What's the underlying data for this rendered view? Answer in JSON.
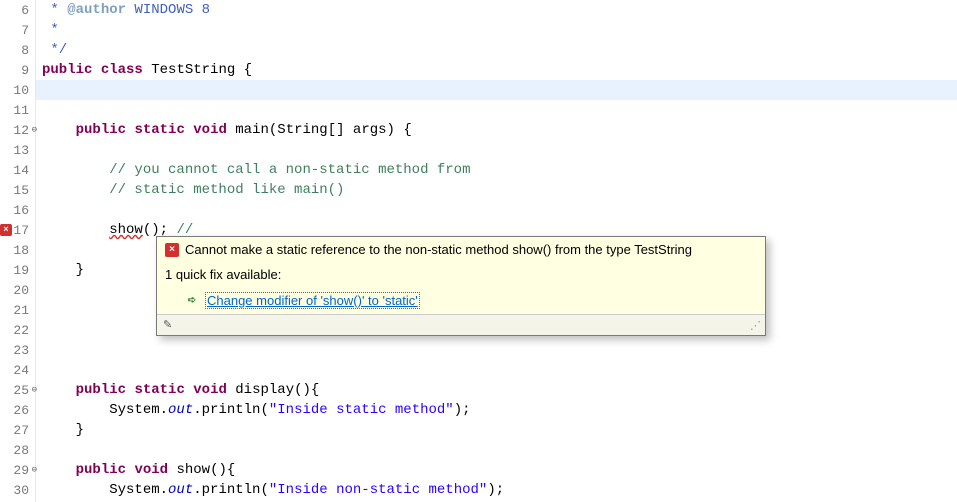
{
  "gutter": {
    "lines": [
      {
        "n": 6
      },
      {
        "n": 7
      },
      {
        "n": 8
      },
      {
        "n": 9
      },
      {
        "n": 10
      },
      {
        "n": 11
      },
      {
        "n": 12,
        "fold": true
      },
      {
        "n": 13
      },
      {
        "n": 14
      },
      {
        "n": 15
      },
      {
        "n": 16
      },
      {
        "n": 17,
        "error": true
      },
      {
        "n": 18
      },
      {
        "n": 19
      },
      {
        "n": 20
      },
      {
        "n": 21
      },
      {
        "n": 22
      },
      {
        "n": 23
      },
      {
        "n": 24
      },
      {
        "n": 25,
        "fold": true
      },
      {
        "n": 26
      },
      {
        "n": 27
      },
      {
        "n": 28
      },
      {
        "n": 29,
        "fold": true
      },
      {
        "n": 30
      }
    ]
  },
  "code": {
    "l6_jdoc_pre": " * ",
    "l6_tag": "@author",
    "l6_author": " WINDOWS 8",
    "l7": " *",
    "l8": " */",
    "l9_kw1": "public",
    "l9_kw2": "class",
    "l9_name": "TestString",
    "l9_brace": " {",
    "l12_kw1": "public",
    "l12_kw2": "static",
    "l12_kw3": "void",
    "l12_m": "main",
    "l12_p_open": "(",
    "l12_ptype": "String[] ",
    "l12_pname": "args",
    "l12_p_close": ") {",
    "l14_c": "// you cannot call a non-static method from",
    "l15_c": "// static method like main()",
    "l17_call": "show",
    "l17_after": "(); ",
    "l17_trail": "//",
    "l19_close": "}",
    "l25_kw1": "public",
    "l25_kw2": "static",
    "l25_kw3": "void",
    "l25_m": "display",
    "l25_sig": "(){",
    "l26_sys": "System.",
    "l26_out": "out",
    "l26_pl": ".println(",
    "l26_s": "\"Inside static method\"",
    "l26_end": ");",
    "l27_close": "}",
    "l29_kw1": "public",
    "l29_kw3": "void",
    "l29_m": "show",
    "l29_sig": "(){",
    "l30_sys": "System.",
    "l30_out": "out",
    "l30_pl": ".println(",
    "l30_s": "\"Inside non-static method\"",
    "l30_end": ");",
    "indent1": "    ",
    "indent2": "        ",
    "space": " "
  },
  "tooltip": {
    "error_msg": "Cannot make a static reference to the non-static method show() from the type TestString",
    "quickfix_header": "1 quick fix available:",
    "quickfix_label": "Change modifier of 'show()' to 'static'",
    "error_glyph": "×",
    "fix_glyph": "➪"
  }
}
